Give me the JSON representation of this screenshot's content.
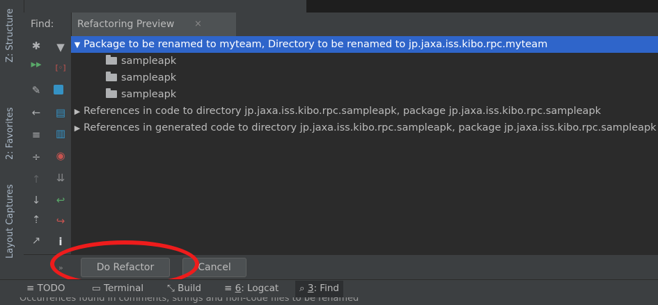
{
  "left_stripe": {
    "structure_tab": "Z: Structure",
    "favorites_tab": "2: Favorites",
    "captures_tab": "Layout Captures"
  },
  "find_panel": {
    "label": "Find:",
    "tab_title": "Refactoring Preview",
    "tab_close": "×"
  },
  "tree": {
    "root": "Package to be renamed to myteam, Directory to be renamed to jp.jaxa.iss.kibo.rpc.myteam",
    "children": [
      "sampleapk",
      "sampleapk",
      "sampleapk"
    ],
    "refs_code": "References in code to directory jp.jaxa.iss.kibo.rpc.sampleapk, package jp.jaxa.iss.kibo.rpc.sampleapk",
    "refs_generated": "References in generated code to directory jp.jaxa.iss.kibo.rpc.sampleapk, package jp.jaxa.iss.kibo.rpc.sampleapk"
  },
  "buttons": {
    "do_refactor": "Do Refactor",
    "cancel": "Cancel"
  },
  "status_tabs": {
    "todo": "TODO",
    "terminal": "Terminal",
    "build": "Build",
    "logcat_num": "6",
    "logcat": ": Logcat",
    "find_num": "3",
    "find": ": Find"
  },
  "status_message": "Occurrences found in comments, strings and non-code files to be renamed",
  "colors": {
    "selection": "#2f65ca",
    "annotation": "#ee1c1c",
    "panel_bg": "#2b2b2b"
  }
}
